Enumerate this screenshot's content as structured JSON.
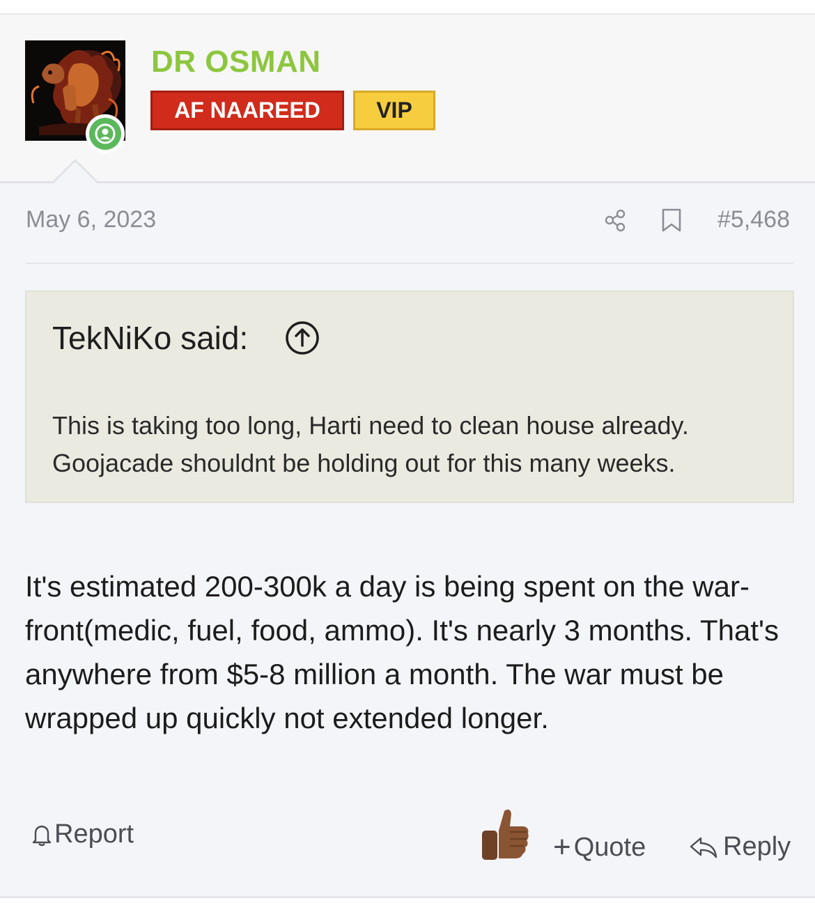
{
  "author": {
    "username": "DR OSMAN",
    "badges": [
      "AF NAAREED",
      "VIP"
    ],
    "avatar_icon": "dog-avatar-icon",
    "online_icon": "user-online-icon"
  },
  "post": {
    "date": "May 6, 2023",
    "number": "#5,468",
    "text": "It's estimated 200-300k a day is being spent on the war-front(medic, fuel, food, ammo). It's nearly 3 months. That's anywhere from $5-8 million a month. The war must be wrapped up quickly not extended longer."
  },
  "quote": {
    "author_line": "TekNiKo said:",
    "text": "This is taking too long, Harti need to clean house already. Goojacade shouldnt be holding out for this many weeks."
  },
  "actions": {
    "report": "Report",
    "quote": "Quote",
    "quote_prefix": "+",
    "reply": "Reply"
  },
  "colors": {
    "username": "#8dc63f",
    "badge_red": "#d12b1b",
    "badge_yellow": "#f6cd3f",
    "quote_bg": "#eaeae0",
    "online": "#5cb85c"
  }
}
